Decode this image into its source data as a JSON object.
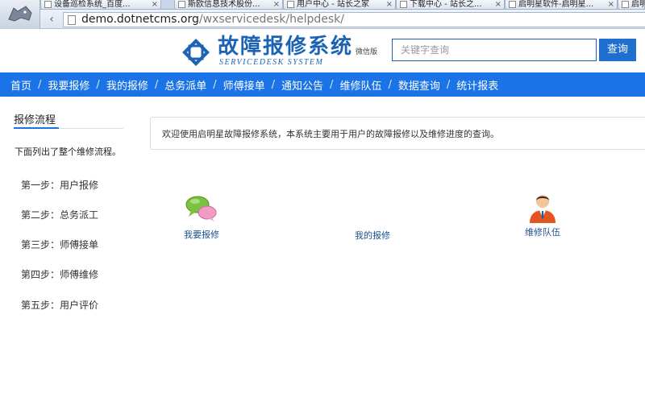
{
  "browser": {
    "tabs": [
      {
        "title": "设备巡检系统_百度..."
      },
      {
        "title": "斯欧信息技术股份..."
      },
      {
        "title": "用户中心 - 站长之家"
      },
      {
        "title": "下载中心 - 站长之..."
      },
      {
        "title": "启明星软件-启明星..."
      },
      {
        "title": "启明"
      }
    ],
    "url_host": "demo.dotnetcms.org",
    "url_path": "/wxservicedesk/helpdesk/"
  },
  "header": {
    "title": "故障报修系统",
    "subtitle": "SERVICEDESK SYSTEM",
    "wechat_label": "微信版",
    "brand_color": "#1d63b4"
  },
  "search": {
    "placeholder": "关键字查询",
    "button_label": "查询"
  },
  "nav": {
    "items": [
      "首页",
      "我要报修",
      "我的报修",
      "总务派单",
      "师傅接单",
      "通知公告",
      "维修队伍",
      "数据查询",
      "统计报表"
    ],
    "separator": "/",
    "background": "#1b73e8"
  },
  "sidebar": {
    "title": "报修流程",
    "description": "下面列出了整个维修流程。",
    "steps": [
      "第一步：用户报修",
      "第二步：总务派工",
      "第三步：师傅接单",
      "第四步：师傅维修",
      "第五步：用户评价"
    ]
  },
  "main": {
    "welcome": "欢迎使用启明星故障报修系统，本系统主要用于用户的故障报修以及维修进度的查询。",
    "quick_links": [
      {
        "label": "我要报修",
        "icon": "chat-bubbles-icon"
      },
      {
        "label": "我的报修",
        "icon": "none"
      },
      {
        "label": "维修队伍",
        "icon": "worker-avatar-icon"
      }
    ]
  }
}
